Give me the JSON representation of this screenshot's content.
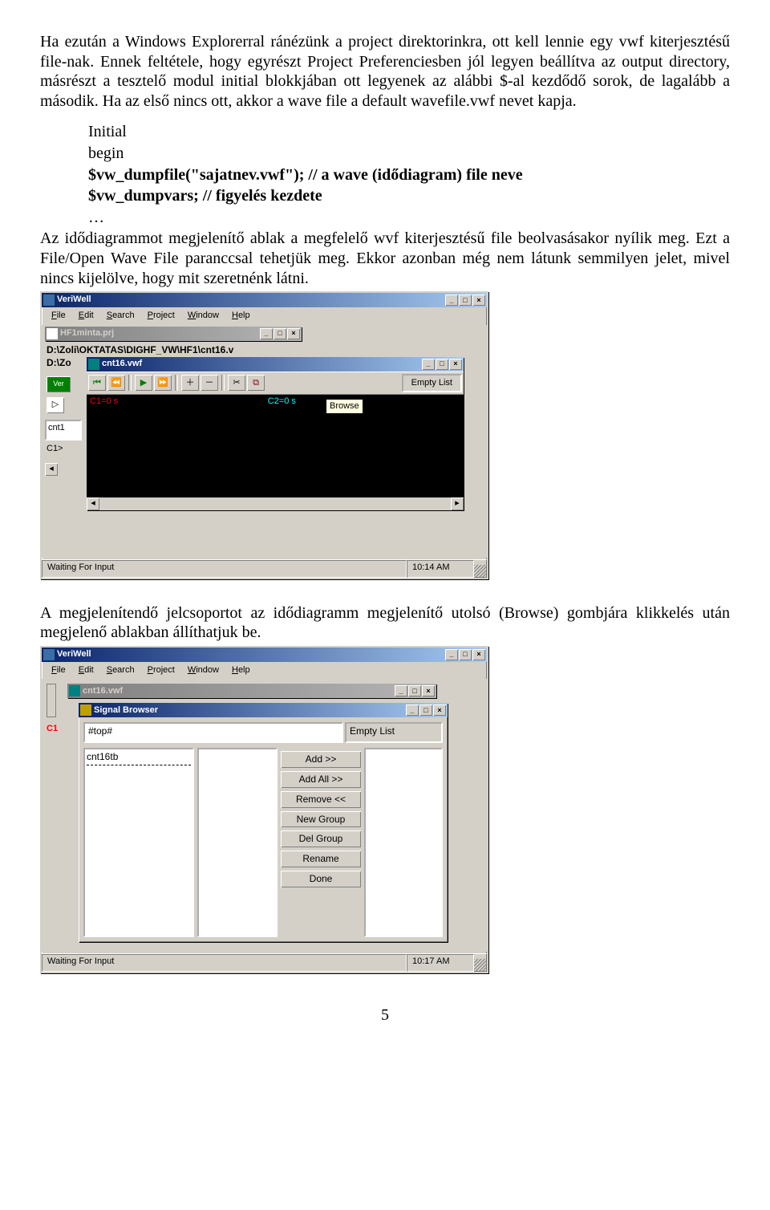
{
  "para1": "Ha ezután a Windows Explorerral ránézünk a project direktorinkra, ott kell lennie egy vwf kiterjesztésű file-nak. Ennek feltétele, hogy egyrészt Project Preferenciesben jól legyen beállítva az output directory, másrészt a tesztelő modul initial blokkjában ott legyenek az alábbi $-al kezdődő sorok, de lagalább a második. Ha az első nincs ott, akkor a wave file a default wavefile.vwf nevet kapja.",
  "code": {
    "l1": "Initial",
    "l2": "begin",
    "l3": "$vw_dumpfile(\"sajatnev.vwf\"); // a wave (idődiagram) file neve",
    "l4": "$vw_dumpvars;  // figyelés kezdete",
    "l5": "…"
  },
  "para2": "Az idődiagrammot megjelenítő ablak a megfelelő wvf kiterjesztésű file beolvasásakor nyílik meg. Ezt a File/Open Wave File paranccsal tehetjük meg. Ekkor azonban még nem látunk semmilyen jelet, mivel nincs kijelölve, hogy mit szeretnénk látni.",
  "para3": "A megjelenítendő jelcsoportot az idődiagramm megjelenítő utolsó (Browse) gombjára klikkelés után megjelenő ablakban állíthatjuk be.",
  "page_number": "5",
  "app": {
    "title": "VeriWell",
    "menus": [
      "File",
      "Edit",
      "Search",
      "Project",
      "Window",
      "Help"
    ],
    "status_left": "Waiting For Input",
    "time1": "10:14 AM",
    "time2": "10:17 AM"
  },
  "win_controls": {
    "min": "_",
    "max": "□",
    "close": "×"
  },
  "shot1": {
    "prj_title": "HF1minta.prj",
    "path1": "D:\\Zoli\\OKTATAS\\DIGHF_VW\\HF1\\cnt16.v",
    "path2": "D:\\Zo",
    "ver_label": "Ver",
    "cnt1": "cnt1",
    "prompt": "C1>",
    "wave_title": "cnt16.vwf",
    "empty_list": "Empty List",
    "c1": "C1=0 s",
    "c2": "C2=0 s",
    "tooltip": "Browse"
  },
  "shot2": {
    "wave_title": "cnt16.vwf",
    "sb_title": "Signal Browser",
    "top": "#top#",
    "tree_item": "cnt16tb",
    "empty_list": "Empty List",
    "buttons": [
      "Add >>",
      "Add All >>",
      "Remove <<",
      "New Group",
      "Del Group",
      "Rename",
      "Done"
    ],
    "c1_label": "C1"
  }
}
